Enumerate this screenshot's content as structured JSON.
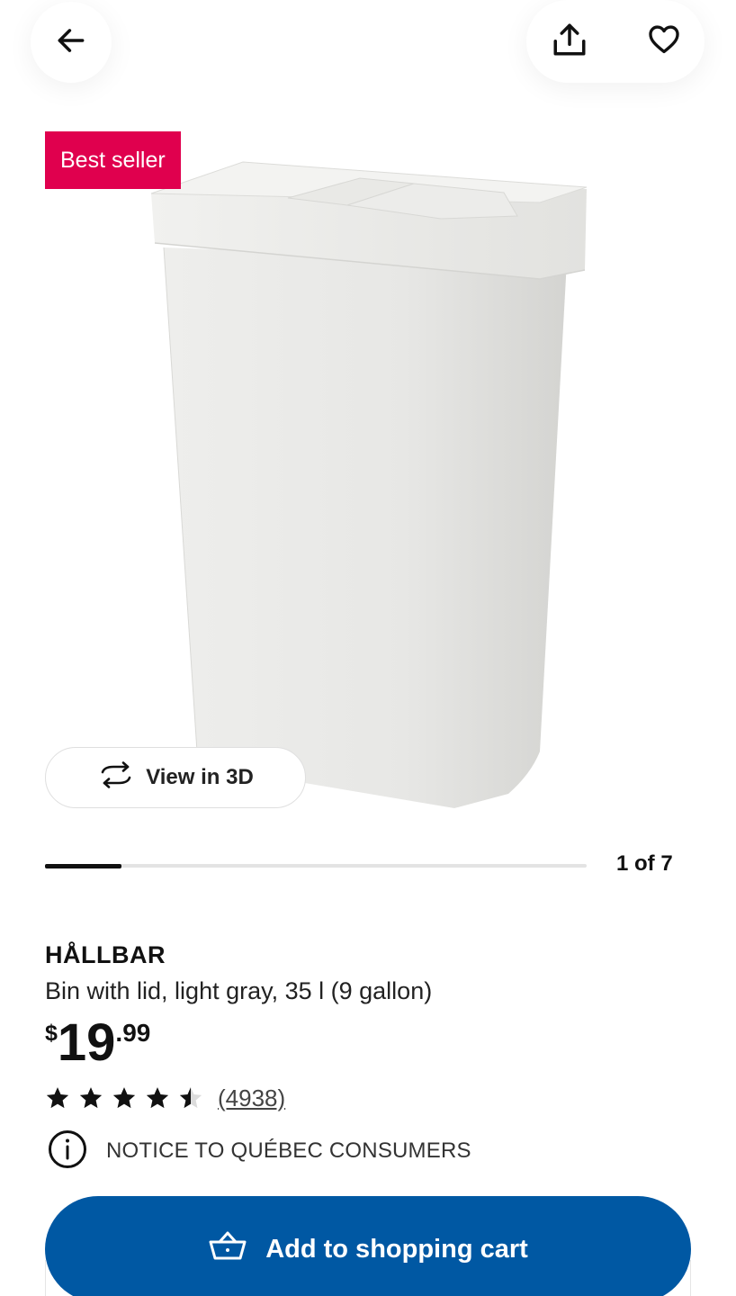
{
  "header": {
    "back_icon": "arrow-left-icon",
    "share_icon": "share-upload-icon",
    "favorite_icon": "heart-outline-icon"
  },
  "badge": {
    "label": "Best seller",
    "color": "#e0004e"
  },
  "gallery": {
    "view3d_label": "View in 3D",
    "view3d_icon": "rotate-3d-icon",
    "counter": "1 of 7",
    "current_index": 1,
    "total_images": 7,
    "progress_fraction": 0.142
  },
  "product": {
    "name": "HÅLLBAR",
    "description": "Bin with lid, light gray, 35 l (9 gallon)",
    "price_currency": "$",
    "price_int": "19",
    "price_decimal": ".99",
    "rating": 4.5,
    "rating_max": 5,
    "review_count": "(4938)"
  },
  "notice": {
    "icon": "info-circle-icon",
    "text": "NOTICE TO QUÉBEC CONSUMERS"
  },
  "cart": {
    "label": "Add to shopping cart",
    "icon": "shopping-basket-icon",
    "color": "#0058a3"
  }
}
